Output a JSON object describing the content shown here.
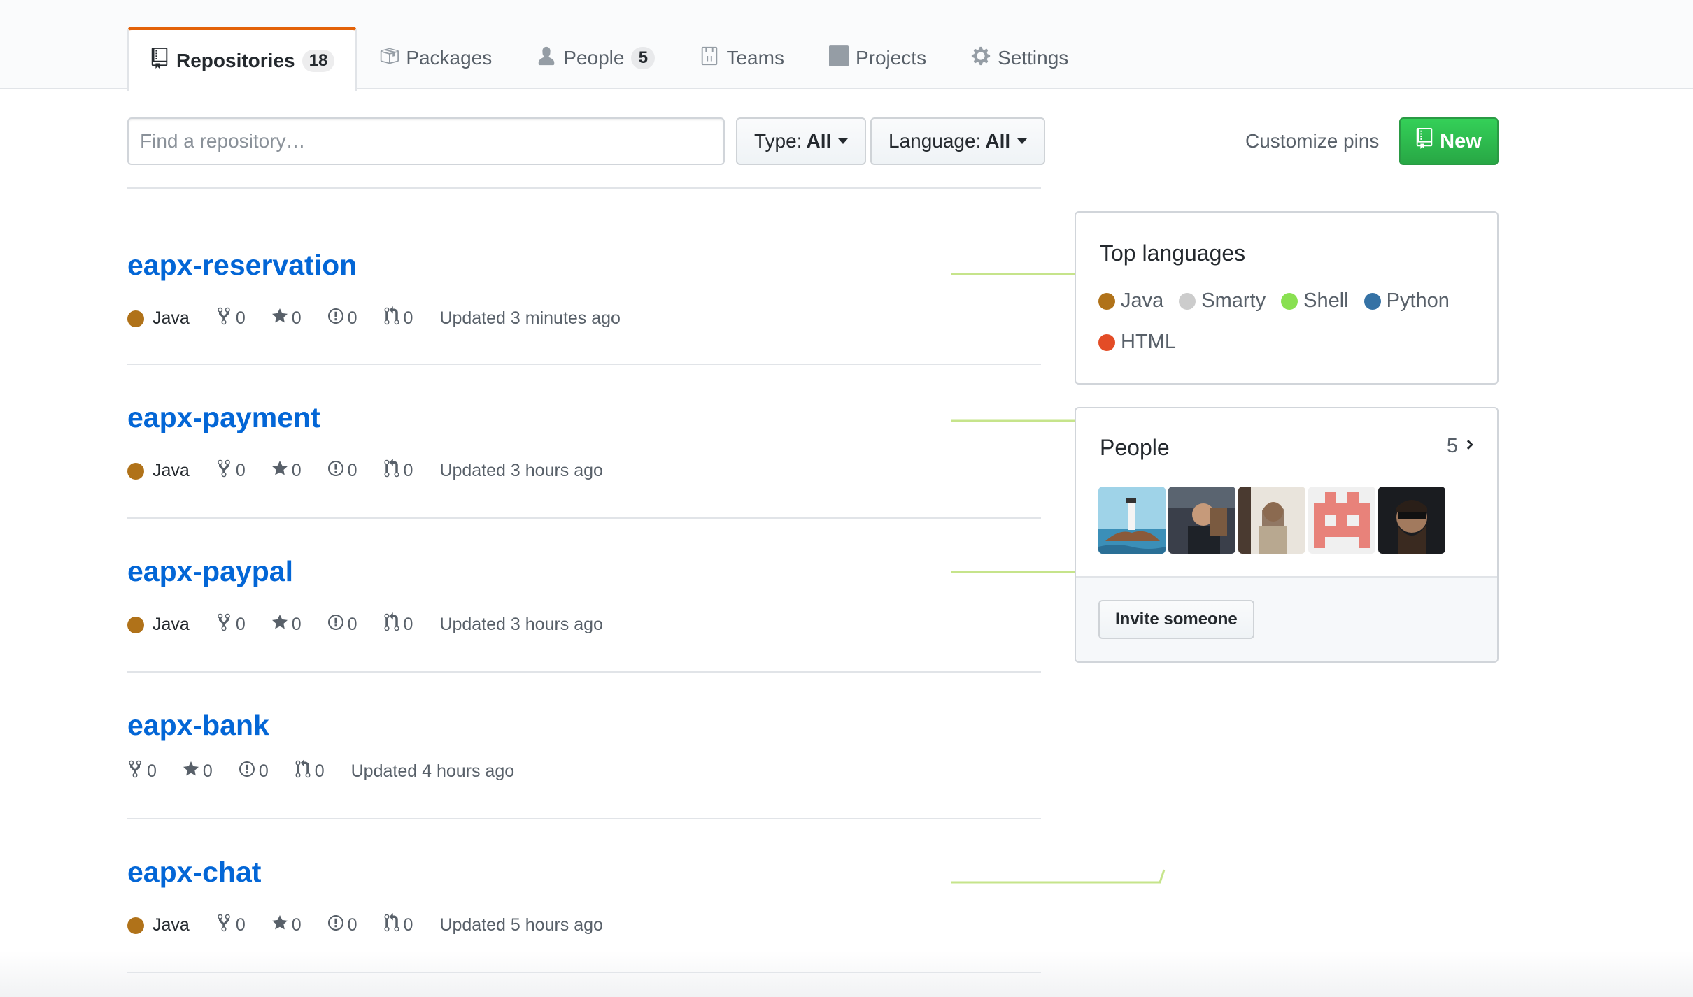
{
  "tabs": [
    {
      "label": "Repositories",
      "count": "18",
      "icon": "repo-icon"
    },
    {
      "label": "Packages",
      "icon": "package-icon"
    },
    {
      "label": "People",
      "count": "5",
      "icon": "person-icon"
    },
    {
      "label": "Teams",
      "icon": "teams-icon"
    },
    {
      "label": "Projects",
      "icon": "project-icon"
    },
    {
      "label": "Settings",
      "icon": "gear-icon"
    }
  ],
  "filters": {
    "search_placeholder": "Find a repository…",
    "type_label": "Type:",
    "type_value": "All",
    "language_label": "Language:",
    "language_value": "All",
    "customize_pins": "Customize pins",
    "new_button": "New"
  },
  "repos": [
    {
      "name": "eapx-reservation",
      "language": "Java",
      "forks": "0",
      "stars": "0",
      "issues": "0",
      "pulls": "0",
      "updated": "Updated 3 minutes ago"
    },
    {
      "name": "eapx-payment",
      "language": "Java",
      "forks": "0",
      "stars": "0",
      "issues": "0",
      "pulls": "0",
      "updated": "Updated 3 hours ago"
    },
    {
      "name": "eapx-paypal",
      "language": "Java",
      "forks": "0",
      "stars": "0",
      "issues": "0",
      "pulls": "0",
      "updated": "Updated 3 hours ago"
    },
    {
      "name": "eapx-bank",
      "language": "",
      "forks": "0",
      "stars": "0",
      "issues": "0",
      "pulls": "0",
      "updated": "Updated 4 hours ago"
    },
    {
      "name": "eapx-chat",
      "language": "Java",
      "forks": "0",
      "stars": "0",
      "issues": "0",
      "pulls": "0",
      "updated": "Updated 5 hours ago"
    }
  ],
  "top_languages": {
    "title": "Top languages",
    "items": [
      {
        "name": "Java",
        "color": "#b07219"
      },
      {
        "name": "Smarty",
        "color": "#cccccc"
      },
      {
        "name": "Shell",
        "color": "#89e051"
      },
      {
        "name": "Python",
        "color": "#3572A5"
      },
      {
        "name": "HTML",
        "color": "#e34c26"
      }
    ]
  },
  "people": {
    "title": "People",
    "count": "5",
    "invite_button": "Invite someone"
  },
  "colors": {
    "accent_tab": "#e36209",
    "link": "#0366d6",
    "new_button": "#28a745",
    "sparkline": "#c6e48b",
    "java": "#b07219"
  }
}
